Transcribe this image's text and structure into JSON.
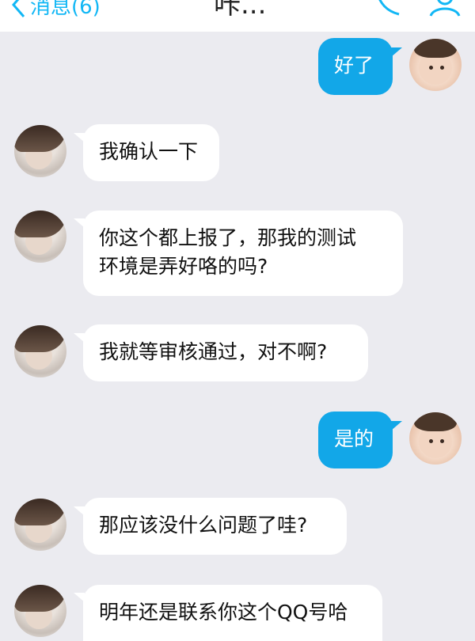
{
  "header": {
    "back_label": "消息(6)",
    "title": "咔..."
  },
  "messages": [
    {
      "side": "right",
      "text": "好了"
    },
    {
      "side": "left",
      "text": "我确认一下"
    },
    {
      "side": "left",
      "text_line1": "你这个都上报了，那我的测试",
      "text_line2": "环境是弄好咯的吗?"
    },
    {
      "side": "left",
      "text": "我就等审核通过，对不啊?"
    },
    {
      "side": "right",
      "text": "是的"
    },
    {
      "side": "left",
      "text": "那应该没什么问题了哇?"
    },
    {
      "side": "left",
      "text": "明年还是联系你这个QQ号哈"
    }
  ],
  "colors": {
    "accent": "#12b7f5",
    "outgoing_bubble": "#12a7e8",
    "incoming_bubble": "#ffffff",
    "background": "#ebebf0"
  },
  "icons": [
    "back-chevron-icon",
    "phone-icon",
    "profile-icon"
  ]
}
